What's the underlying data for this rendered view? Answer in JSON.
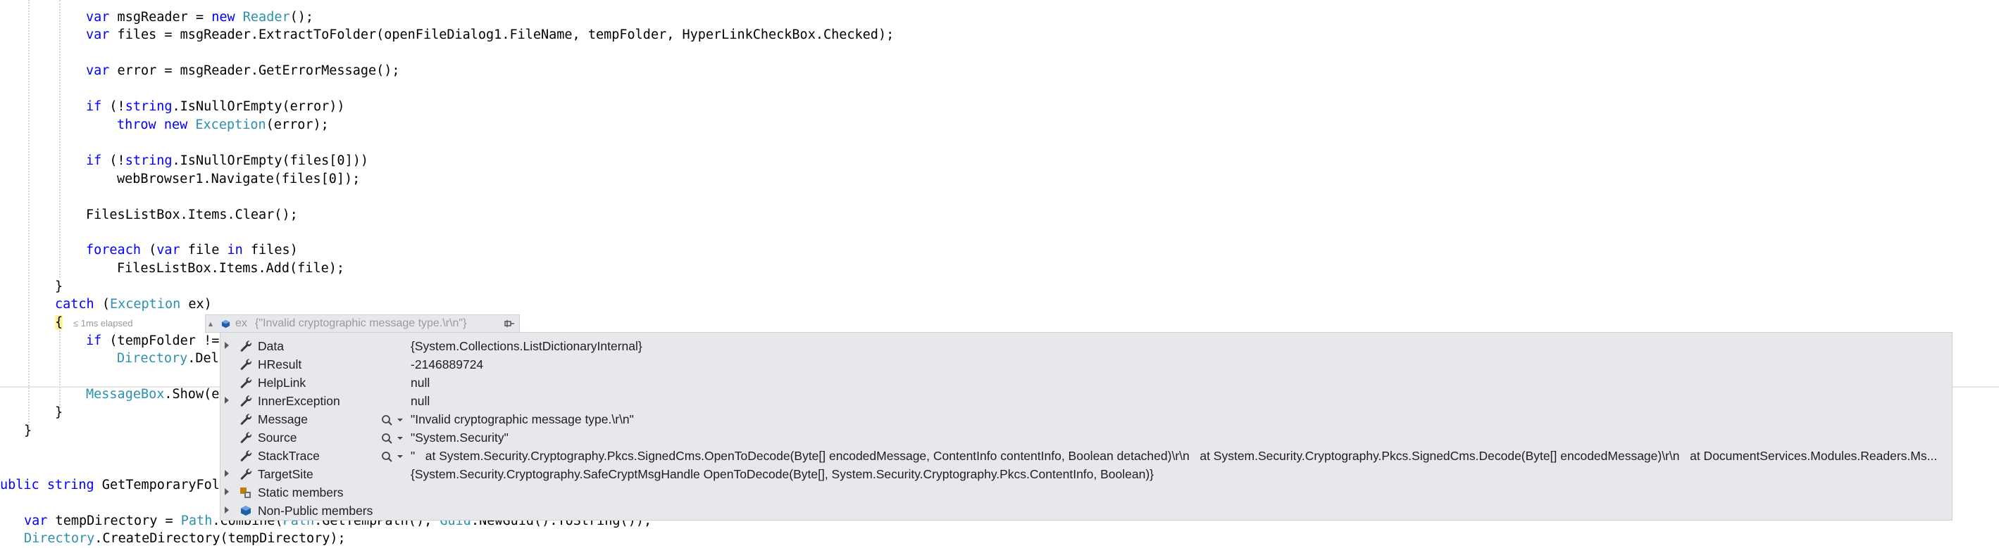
{
  "code": {
    "l1_var": "var",
    "l1_a": " msgReader = ",
    "l1_new": "new",
    "l1_sp": " ",
    "l1_type": "Reader",
    "l1_b": "();",
    "l2_var": "var",
    "l2_a": " files = msgReader.ExtractToFolder(openFileDialog1.FileName, tempFolder, HyperLinkCheckBox.Checked);",
    "l3_var": "var",
    "l3_a": " error = msgReader.GetErrorMessage();",
    "l4_if": "if",
    "l4_a": " (!",
    "l4_string": "string",
    "l4_b": ".IsNullOrEmpty(error))",
    "l5_throw": "throw",
    "l5_sp": " ",
    "l5_new": "new",
    "l5_sp2": " ",
    "l5_type": "Exception",
    "l5_a": "(error);",
    "l6_if": "if",
    "l6_a": " (!",
    "l6_string": "string",
    "l6_b": ".IsNullOrEmpty(files[0]))",
    "l7": "webBrowser1.Navigate(files[0]);",
    "l8": "FilesListBox.Items.Clear();",
    "l9_foreach": "foreach",
    "l9_a": " (",
    "l9_var": "var",
    "l9_b": " file ",
    "l9_in": "in",
    "l9_c": " files)",
    "l10": "FilesListBox.Items.Add(file);",
    "l11": "}",
    "l12_catch": "catch",
    "l12_a": " (",
    "l12_type": "Exception",
    "l12_b": " ex)",
    "l13": "{",
    "elapsed": "≤ 1ms elapsed",
    "l14_if": "if",
    "l14_a": " (tempFolder !=",
    "l15_type": "Directory",
    "l15_a": ".Del",
    "l16_type": "MessageBox",
    "l16_a": ".Show(e",
    "l17": "}",
    "l18": "}",
    "l19_public": "ublic",
    "l19_sp": " ",
    "l19_string": "string",
    "l19_a": " GetTemporaryFol",
    "l20_var": "var",
    "l20_a": " tempDirectory = ",
    "l20_path": "Path",
    "l20_b": ".Combine(",
    "l20_path2": "Path",
    "l20_c": ".GetTempPath(), ",
    "l20_guid": "Guid",
    "l20_d": ".NewGuid().ToString());",
    "l21_type": "Directory",
    "l21_a": ".CreateDirectory(tempDirectory);"
  },
  "datatip": {
    "header_name": "ex",
    "header_value": "{\"Invalid cryptographic message type.\\r\\n\"}",
    "rows": [
      {
        "name": "Data",
        "value": "{System.Collections.ListDictionaryInternal}",
        "icon": "wrench-icon"
      },
      {
        "name": "HResult",
        "value": "-2146889724",
        "icon": "wrench-icon"
      },
      {
        "name": "HelpLink",
        "value": "null",
        "icon": "wrench-icon"
      },
      {
        "name": "InnerException",
        "value": "null",
        "icon": "wrench-icon"
      },
      {
        "name": "Message",
        "value": "\"Invalid cryptographic message type.\\r\\n\"",
        "icon": "wrench-icon"
      },
      {
        "name": "Source",
        "value": "\"System.Security\"",
        "icon": "wrench-icon"
      },
      {
        "name": "StackTrace",
        "value": "\"   at System.Security.Cryptography.Pkcs.SignedCms.OpenToDecode(Byte[] encodedMessage, ContentInfo contentInfo, Boolean detached)\\r\\n   at System.Security.Cryptography.Pkcs.SignedCms.Decode(Byte[] encodedMessage)\\r\\n   at DocumentServices.Modules.Readers.Ms...",
        "icon": "wrench-icon"
      },
      {
        "name": "TargetSite",
        "value": "{System.Security.Cryptography.SafeCryptMsgHandle OpenToDecode(Byte[], System.Security.Cryptography.Pkcs.ContentInfo, Boolean)}",
        "icon": "wrench-icon"
      },
      {
        "name": "Static members",
        "value": "",
        "icon": "static-members-icon"
      },
      {
        "name": "Non-Public members",
        "value": "",
        "icon": "object-icon"
      }
    ]
  },
  "colors": {
    "keyword": "#0000ff",
    "type": "#2b91af",
    "datatip_bg": "#e7e8ec",
    "brace_highlight": "#fff59a",
    "wrench": "#3a3a3a",
    "object_icon": "#1e5fa8"
  }
}
